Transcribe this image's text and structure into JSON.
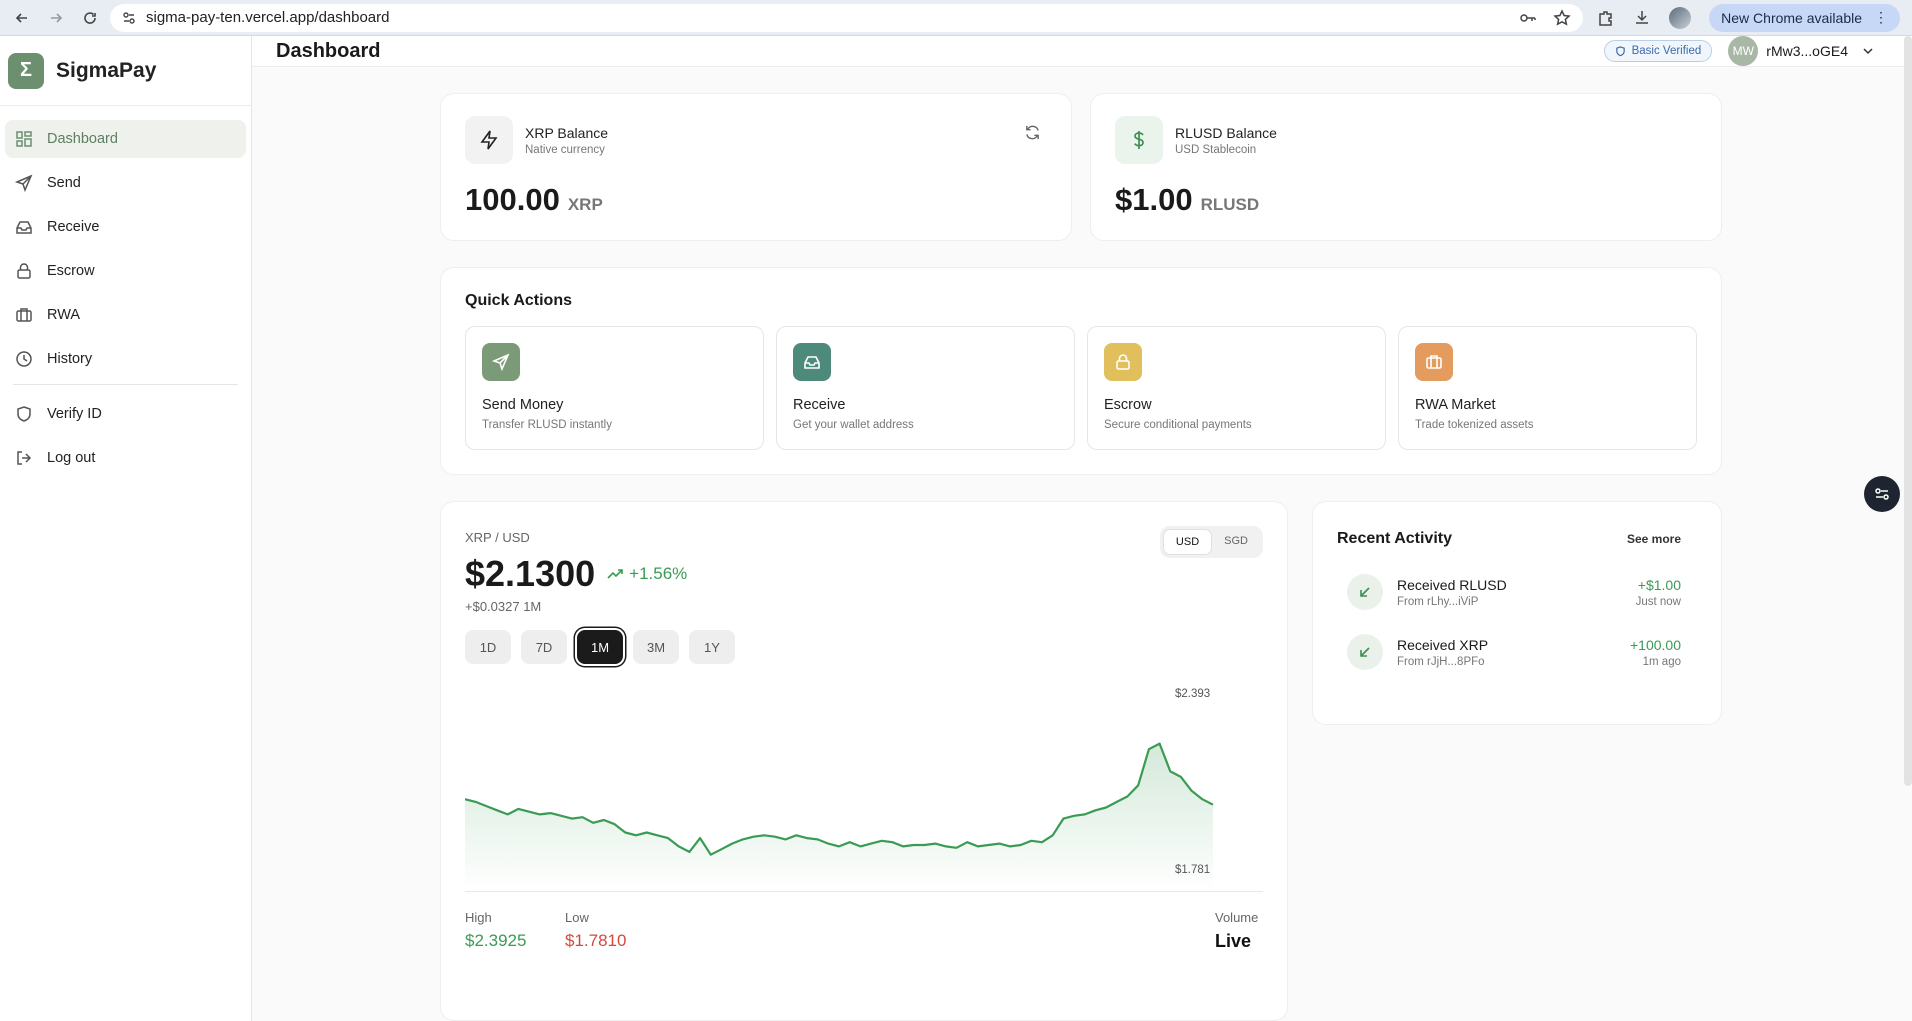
{
  "browser": {
    "url": "sigma-pay-ten.vercel.app/dashboard",
    "chrome_notice": "New Chrome available"
  },
  "sidebar": {
    "brand_logo": "Σ",
    "brand_name": "SigmaPay",
    "items": [
      {
        "label": "Dashboard",
        "icon": "dashboard-icon",
        "active": true
      },
      {
        "label": "Send",
        "icon": "send-icon"
      },
      {
        "label": "Receive",
        "icon": "inbox-icon"
      },
      {
        "label": "Escrow",
        "icon": "lock-icon"
      },
      {
        "label": "RWA",
        "icon": "briefcase-icon"
      },
      {
        "label": "History",
        "icon": "clock-icon"
      },
      {
        "label": "Verify ID",
        "icon": "shield-icon"
      },
      {
        "label": "Log out",
        "icon": "logout-icon"
      }
    ]
  },
  "header": {
    "title": "Dashboard",
    "verify_badge": "Basic Verified",
    "avatar_initials": "MW",
    "account": "rMw3...oGE4"
  },
  "balances": {
    "xrp": {
      "name": "XRP Balance",
      "sub": "Native currency",
      "amount": "100.00",
      "unit": "XRP"
    },
    "rlusd": {
      "name": "RLUSD Balance",
      "sub": "USD Stablecoin",
      "amount": "$1.00",
      "unit": "RLUSD"
    }
  },
  "quick_actions": {
    "title": "Quick Actions",
    "items": [
      {
        "name": "Send Money",
        "desc": "Transfer RLUSD instantly",
        "color": "#7a9a78"
      },
      {
        "name": "Receive",
        "desc": "Get your wallet address",
        "color": "#4e8a7c"
      },
      {
        "name": "Escrow",
        "desc": "Secure conditional payments",
        "color": "#e0bf5c"
      },
      {
        "name": "RWA Market",
        "desc": "Trade tokenized assets",
        "color": "#e39b5e"
      }
    ]
  },
  "price_card": {
    "pair": "XRP / USD",
    "price": "$2.1300",
    "change_pct": "+1.56%",
    "change_abs": "+$0.0327 1M",
    "currencies": [
      "USD",
      "SGD"
    ],
    "active_currency": "USD",
    "ranges": [
      "1D",
      "7D",
      "1M",
      "3M",
      "1Y"
    ],
    "active_range": "1M",
    "chart_hi_label": "$2.393",
    "chart_lo_label": "$1.781",
    "stats": {
      "high_label": "High",
      "high_value": "$2.3925",
      "low_label": "Low",
      "low_value": "$1.7810",
      "volume_label": "Volume",
      "volume_value": "Live"
    }
  },
  "chart_data": {
    "type": "area",
    "title": "",
    "xlabel": "",
    "ylabel": "",
    "ylim": [
      1.781,
      2.393
    ],
    "color": "#3a9b55",
    "values": [
      2.0,
      1.99,
      1.975,
      1.96,
      1.945,
      1.965,
      1.955,
      1.945,
      1.95,
      1.94,
      1.93,
      1.935,
      1.915,
      1.925,
      1.91,
      1.88,
      1.87,
      1.88,
      1.87,
      1.86,
      1.83,
      1.81,
      1.86,
      1.8,
      1.82,
      1.84,
      1.855,
      1.865,
      1.87,
      1.865,
      1.855,
      1.87,
      1.86,
      1.855,
      1.84,
      1.83,
      1.845,
      1.83,
      1.84,
      1.85,
      1.845,
      1.83,
      1.835,
      1.835,
      1.84,
      1.83,
      1.825,
      1.845,
      1.83,
      1.835,
      1.84,
      1.83,
      1.835,
      1.85,
      1.845,
      1.87,
      1.93,
      1.94,
      1.945,
      1.96,
      1.97,
      1.99,
      2.01,
      2.05,
      2.18,
      2.2,
      2.1,
      2.08,
      2.03,
      2.0,
      1.98
    ]
  },
  "activity": {
    "title": "Recent Activity",
    "see_more": "See more",
    "items": [
      {
        "name": "Received RLUSD",
        "from": "From rLhy...iViP",
        "amount": "+$1.00",
        "time": "Just now"
      },
      {
        "name": "Received XRP",
        "from": "From rJjH...8PFo",
        "amount": "+100.00",
        "time": "1m ago"
      }
    ]
  }
}
